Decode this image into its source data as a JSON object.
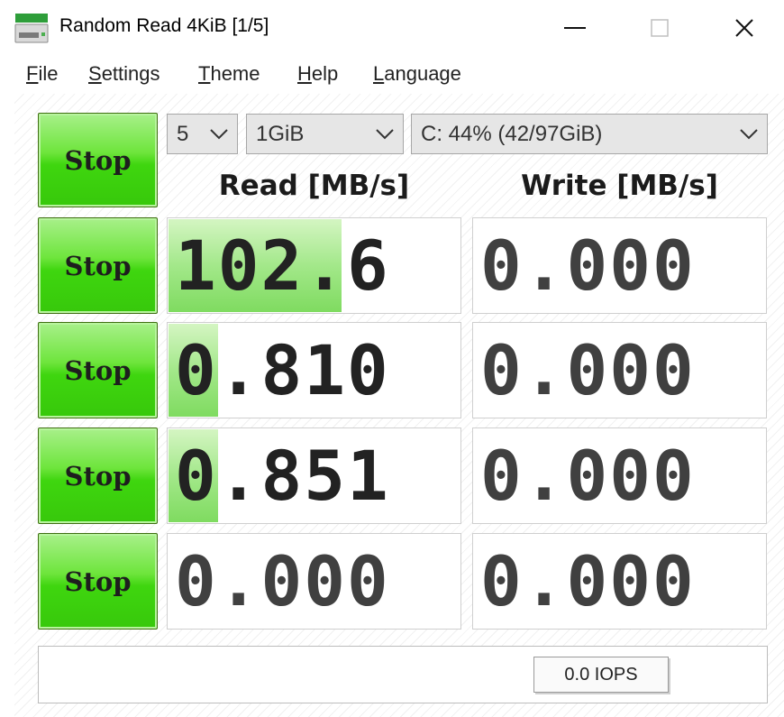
{
  "window": {
    "title": "Random Read 4KiB [1/5]"
  },
  "menu": [
    {
      "accel": "F",
      "rest": "ile"
    },
    {
      "accel": "S",
      "rest": "ettings"
    },
    {
      "accel": "T",
      "rest": "heme"
    },
    {
      "accel": "H",
      "rest": "elp"
    },
    {
      "accel": "L",
      "rest": "anguage"
    }
  ],
  "controls": {
    "all_button": "Stop",
    "count_select": "5",
    "size_select": "1GiB",
    "drive_select": "C: 44% (42/97GiB)"
  },
  "headers": {
    "read": "Read [MB/s]",
    "write": "Write [MB/s]"
  },
  "rows": [
    {
      "button": "Stop",
      "read": "102.6",
      "write": "0.000",
      "read_progress": 0.59
    },
    {
      "button": "Stop",
      "read": "0.810",
      "write": "0.000",
      "read_progress": 0.17
    },
    {
      "button": "Stop",
      "read": "0.851",
      "write": "0.000",
      "read_progress": 0.17
    },
    {
      "button": "Stop",
      "read": "0.000",
      "write": "0.000",
      "read_progress": 0.0
    }
  ],
  "status": {
    "iops": "0.0 IOPS"
  },
  "colors": {
    "button_green": "#3fd60f",
    "bar_green": "#7fdb60"
  }
}
